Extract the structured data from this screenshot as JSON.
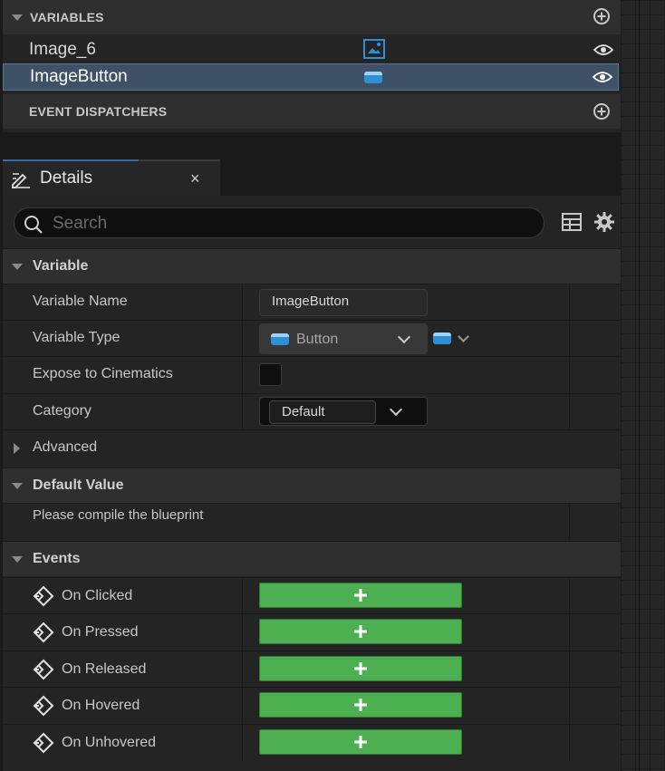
{
  "variables_panel": {
    "header": "VARIABLES",
    "items": [
      {
        "name": "Image_6",
        "type_icon": "image-type-icon",
        "visibility_icon": "eye-icon"
      },
      {
        "name": "ImageButton",
        "type_icon": "button-type-icon",
        "visibility_icon": "eye-icon",
        "selected": true
      }
    ],
    "dispatchers_header": "EVENT DISPATCHERS"
  },
  "details_tab": {
    "title": "Details",
    "close": "×"
  },
  "search": {
    "placeholder": "Search"
  },
  "variable_section": {
    "title": "Variable",
    "name_label": "Variable Name",
    "name_value": "ImageButton",
    "type_label": "Variable Type",
    "type_value": "Button",
    "expose_label": "Expose to Cinematics",
    "expose_checked": false,
    "category_label": "Category",
    "category_value": "Default",
    "advanced_label": "Advanced"
  },
  "default_value_section": {
    "title": "Default Value",
    "message": "Please compile the blueprint"
  },
  "events_section": {
    "title": "Events",
    "events": [
      "On Clicked",
      "On Pressed",
      "On Released",
      "On Hovered",
      "On Unhovered"
    ]
  },
  "colors": {
    "accent_green": "#4caf50",
    "selection_blue": "#3e5167",
    "type_blue": "#2d8fd6"
  }
}
